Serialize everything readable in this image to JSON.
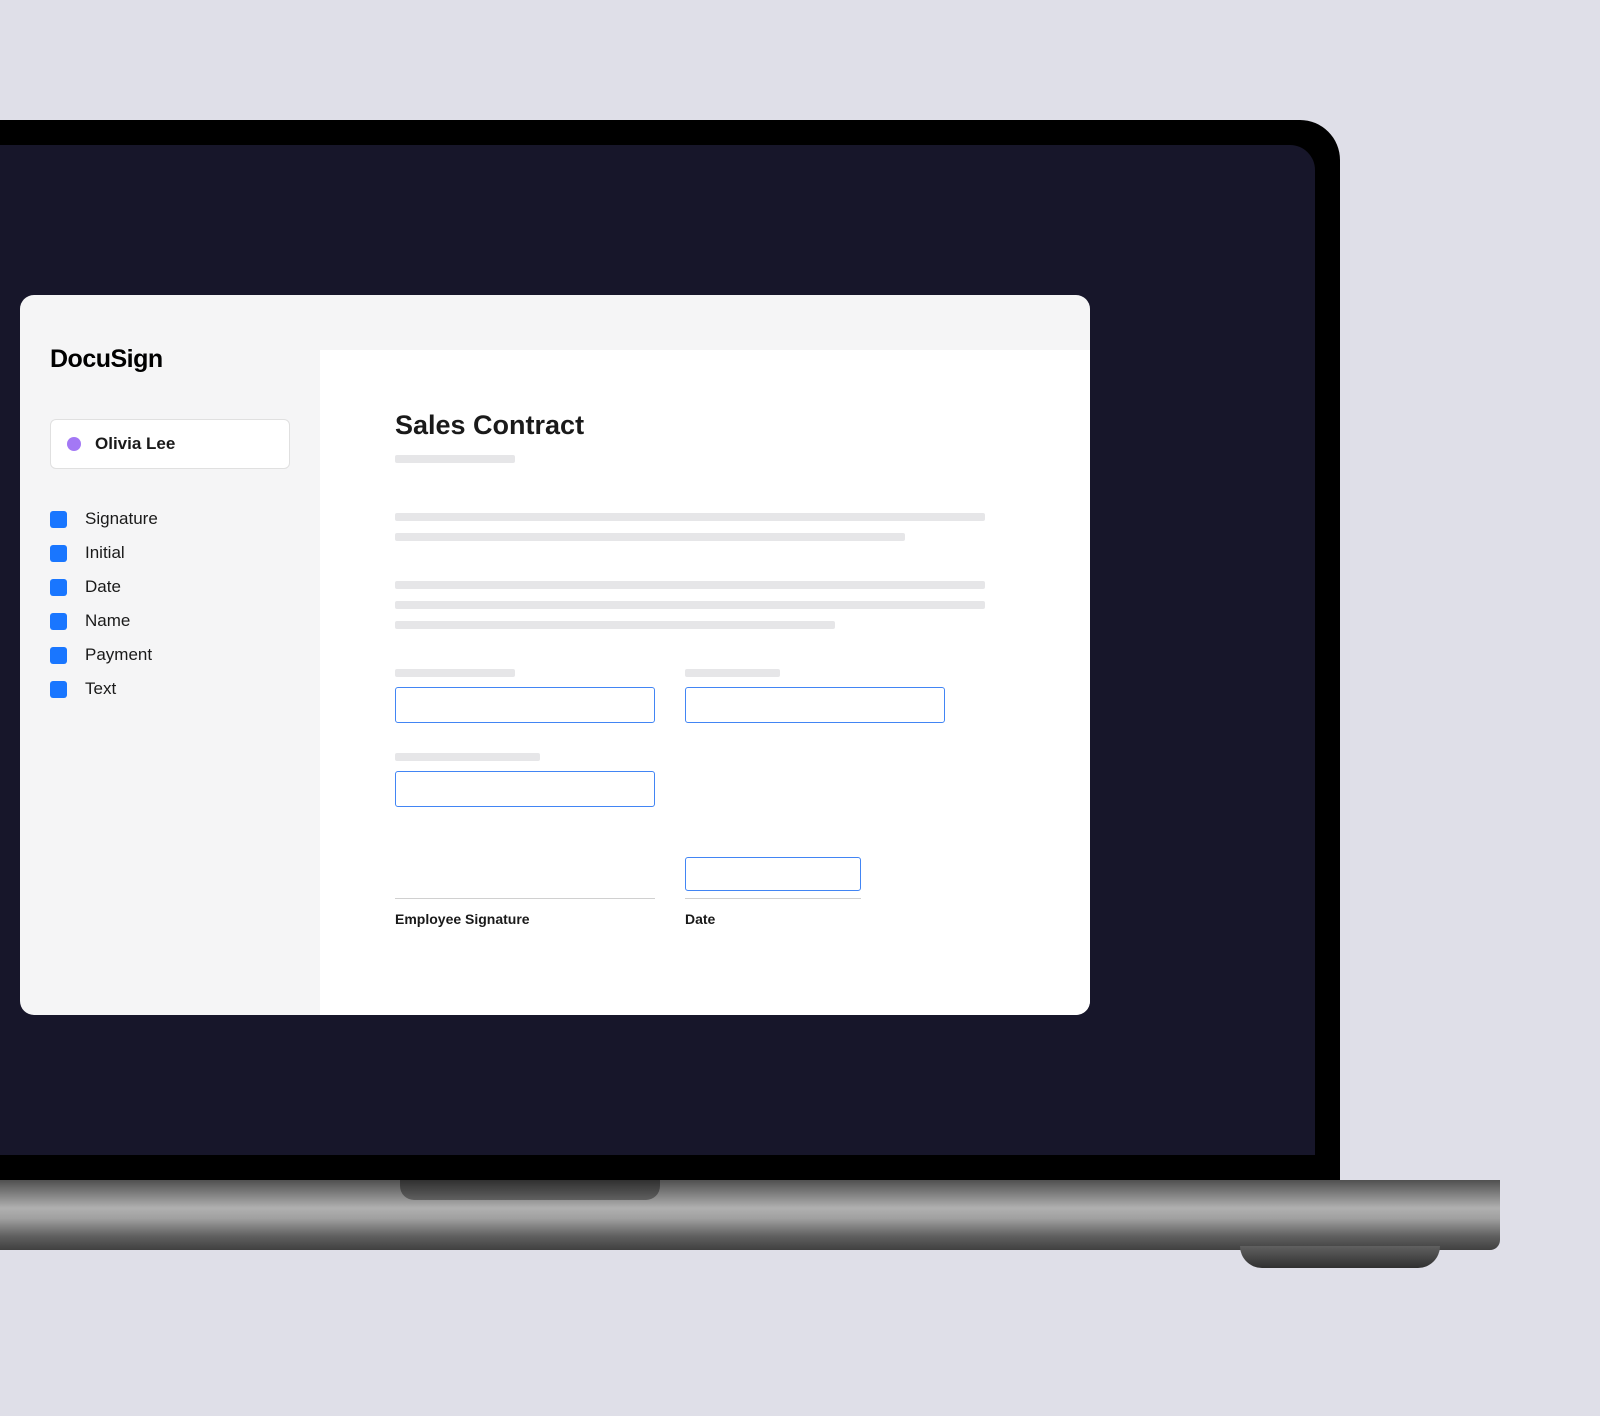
{
  "brand": "DocuSign",
  "recipient": {
    "name": "Olivia Lee",
    "color": "#a378f5"
  },
  "fields": [
    {
      "label": "Signature"
    },
    {
      "label": "Initial"
    },
    {
      "label": "Date"
    },
    {
      "label": "Name"
    },
    {
      "label": "Payment"
    },
    {
      "label": "Text"
    }
  ],
  "document": {
    "title": "Sales Contract",
    "signature_label": "Employee Signature",
    "date_label": "Date"
  },
  "colors": {
    "field_accent": "#1976ff",
    "input_border": "#4285f4"
  }
}
